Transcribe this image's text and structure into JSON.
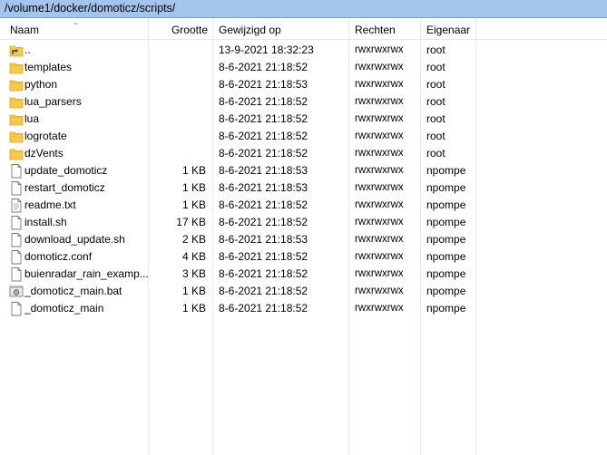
{
  "path": "/volume1/docker/domoticz/scripts/",
  "columns": {
    "name": "Naam",
    "size": "Grootte",
    "modified": "Gewijzigd op",
    "rights": "Rechten",
    "owner": "Eigenaar"
  },
  "files": [
    {
      "name": "..",
      "size": "",
      "modified": "13-9-2021 18:32:23",
      "rights": "rwxrwxrwx",
      "owner": "root",
      "icon": "parent-folder-icon"
    },
    {
      "name": "templates",
      "size": "",
      "modified": "8-6-2021 21:18:52",
      "rights": "rwxrwxrwx",
      "owner": "root",
      "icon": "folder-icon"
    },
    {
      "name": "python",
      "size": "",
      "modified": "8-6-2021 21:18:53",
      "rights": "rwxrwxrwx",
      "owner": "root",
      "icon": "folder-icon"
    },
    {
      "name": "lua_parsers",
      "size": "",
      "modified": "8-6-2021 21:18:52",
      "rights": "rwxrwxrwx",
      "owner": "root",
      "icon": "folder-icon"
    },
    {
      "name": "lua",
      "size": "",
      "modified": "8-6-2021 21:18:52",
      "rights": "rwxrwxrwx",
      "owner": "root",
      "icon": "folder-icon"
    },
    {
      "name": "logrotate",
      "size": "",
      "modified": "8-6-2021 21:18:52",
      "rights": "rwxrwxrwx",
      "owner": "root",
      "icon": "folder-icon"
    },
    {
      "name": "dzVents",
      "size": "",
      "modified": "8-6-2021 21:18:52",
      "rights": "rwxrwxrwx",
      "owner": "root",
      "icon": "folder-icon"
    },
    {
      "name": "update_domoticz",
      "size": "1 KB",
      "modified": "8-6-2021 21:18:53",
      "rights": "rwxrwxrwx",
      "owner": "npompe",
      "icon": "file-icon"
    },
    {
      "name": "restart_domoticz",
      "size": "1 KB",
      "modified": "8-6-2021 21:18:53",
      "rights": "rwxrwxrwx",
      "owner": "npompe",
      "icon": "file-icon"
    },
    {
      "name": "readme.txt",
      "size": "1 KB",
      "modified": "8-6-2021 21:18:52",
      "rights": "rwxrwxrwx",
      "owner": "npompe",
      "icon": "text-file-icon"
    },
    {
      "name": "install.sh",
      "size": "17 KB",
      "modified": "8-6-2021 21:18:52",
      "rights": "rwxrwxrwx",
      "owner": "npompe",
      "icon": "file-icon"
    },
    {
      "name": "download_update.sh",
      "size": "2 KB",
      "modified": "8-6-2021 21:18:53",
      "rights": "rwxrwxrwx",
      "owner": "npompe",
      "icon": "file-icon"
    },
    {
      "name": "domoticz.conf",
      "size": "4 KB",
      "modified": "8-6-2021 21:18:52",
      "rights": "rwxrwxrwx",
      "owner": "npompe",
      "icon": "file-icon"
    },
    {
      "name": "buienradar_rain_examp...",
      "size": "3 KB",
      "modified": "8-6-2021 21:18:52",
      "rights": "rwxrwxrwx",
      "owner": "npompe",
      "icon": "file-icon"
    },
    {
      "name": "_domoticz_main.bat",
      "size": "1 KB",
      "modified": "8-6-2021 21:18:52",
      "rights": "rwxrwxrwx",
      "owner": "npompe",
      "icon": "batch-file-icon"
    },
    {
      "name": "_domoticz_main",
      "size": "1 KB",
      "modified": "8-6-2021 21:18:52",
      "rights": "rwxrwxrwx",
      "owner": "npompe",
      "icon": "file-icon"
    }
  ],
  "colors": {
    "pathbar_bg": "#a3c4ec",
    "folder": "#f7c948"
  }
}
